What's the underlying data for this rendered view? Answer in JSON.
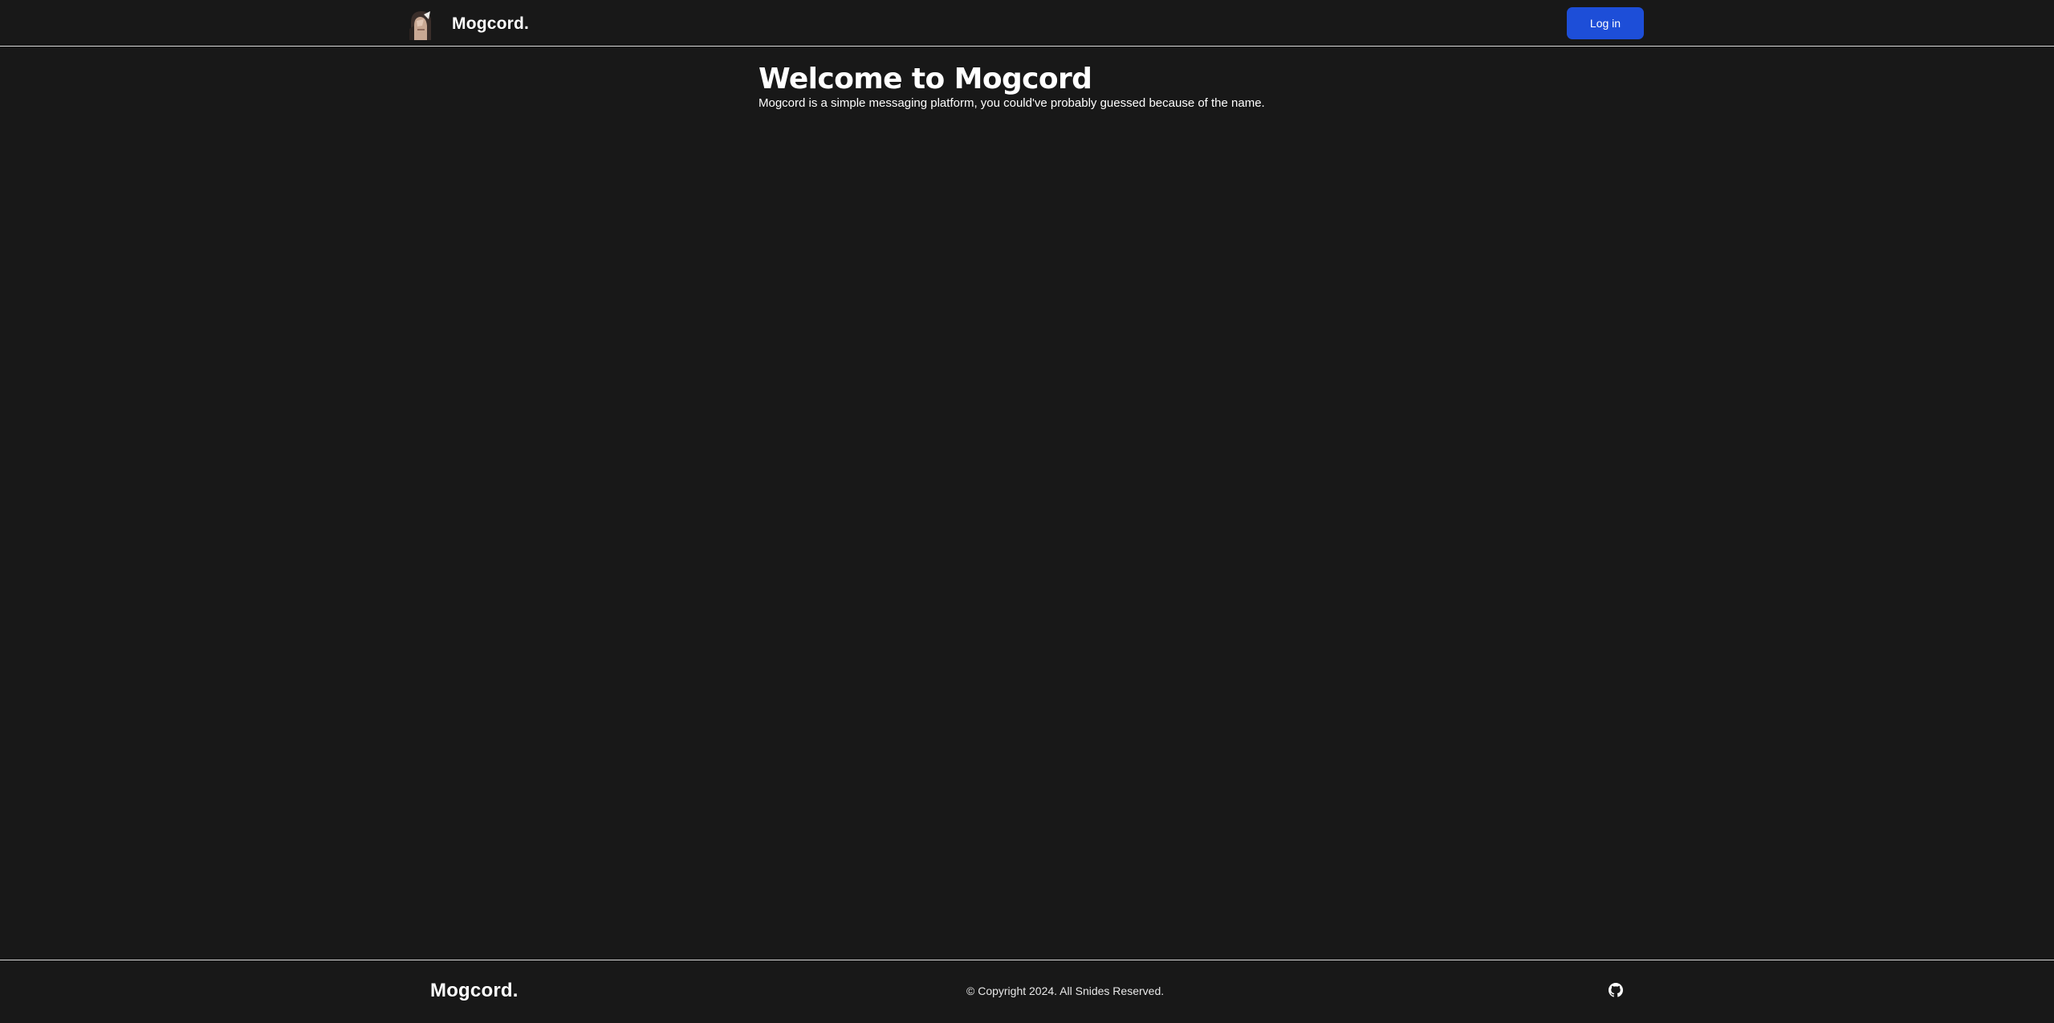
{
  "navbar": {
    "brand_name": "Mogcord.",
    "logo_icon": "avatar-icon",
    "login_label": "Log in"
  },
  "main": {
    "title": "Welcome to Mogcord",
    "subtitle": "Mogcord is a simple messaging platform, you could've probably guessed because of the name."
  },
  "footer": {
    "brand_name": "Mogcord.",
    "copyright": "© Copyright 2024. All Snides Reserved.",
    "social_icon": "github-icon"
  },
  "colors": {
    "background": "#181818",
    "text": "#ffffff",
    "accent": "#1d4ed8",
    "divider": "#d6d6d6"
  }
}
